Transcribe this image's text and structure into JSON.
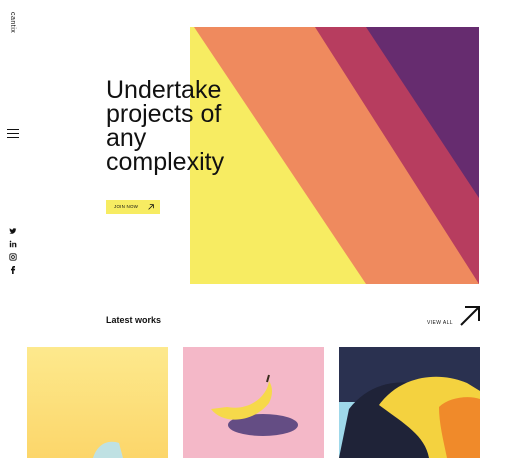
{
  "brand": "cantix",
  "hero": {
    "title": "Undertake projects of any complexity",
    "cta_label": "JOIN NOW"
  },
  "social": [
    "twitter-icon",
    "linkedin-icon",
    "instagram-icon",
    "facebook-icon"
  ],
  "latest": {
    "heading": "Latest works",
    "view_all": "VIEW ALL"
  },
  "colors": {
    "accent_yellow": "#f7ec62",
    "orange": "#ef8a5e",
    "crimson": "#b73d5f",
    "purple": "#662c6f"
  }
}
